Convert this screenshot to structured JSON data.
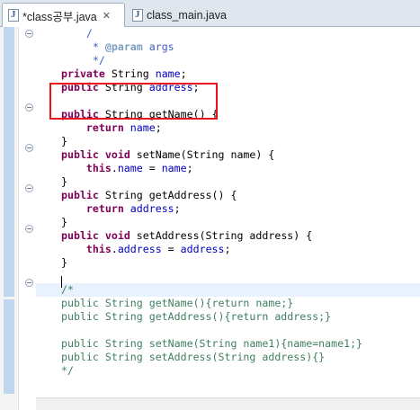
{
  "tabs": [
    {
      "label": "*class공부.java",
      "close": "✕",
      "icon": "java-file-icon",
      "active": true
    },
    {
      "label": "class_main.java",
      "icon": "java-file-icon",
      "active": false
    }
  ],
  "code": {
    "lines": [
      {
        "t": "/",
        "c": "jd",
        "indent": "    "
      },
      {
        "t": "* @param args",
        "c": "jd",
        "indent": "     "
      },
      {
        "t": "*/",
        "c": "jd",
        "indent": "     "
      },
      {
        "t": "private String name;"
      },
      {
        "t": "public String address;"
      },
      {
        "t": ""
      },
      {
        "t": "public String getName() {"
      },
      {
        "t": "    return name;"
      },
      {
        "t": "}"
      },
      {
        "t": "public void setName(String name) {"
      },
      {
        "t": "    this.name = name;"
      },
      {
        "t": "}"
      },
      {
        "t": "public String getAddress() {"
      },
      {
        "t": "    return address;"
      },
      {
        "t": "}"
      },
      {
        "t": "public void setAddress(String address) {"
      },
      {
        "t": "    this.address = address;"
      },
      {
        "t": "}"
      },
      {
        "t": ""
      },
      {
        "t": "/*",
        "c": "cmt"
      },
      {
        "t": "public String getName(){return name;}",
        "c": "cmt"
      },
      {
        "t": "public String getAddress(){return address;}",
        "c": "cmt"
      },
      {
        "t": "",
        "c": "cmt"
      },
      {
        "t": "public String setName(String name1){name=name1;}",
        "c": "cmt"
      },
      {
        "t": "public String setAddress(String address){}",
        "c": "cmt"
      },
      {
        "t": "*/",
        "c": "cmt"
      }
    ]
  },
  "colors": {
    "keyword": "#7f0055",
    "field": "#0000c0",
    "comment": "#3f7f5f",
    "javadoc": "#3f5fbf",
    "highlight_box": "#e8131f",
    "current_line": "#e8f2fe"
  }
}
